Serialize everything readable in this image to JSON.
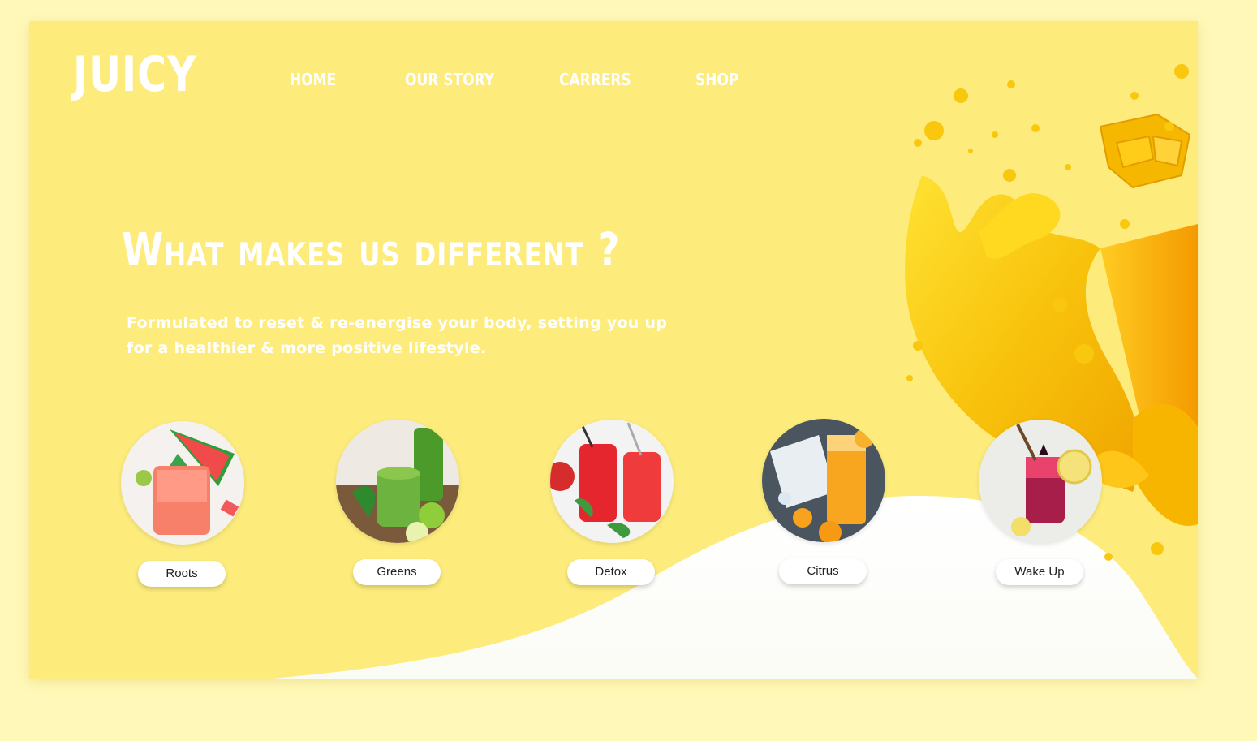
{
  "brand": {
    "logo": "JUICY"
  },
  "nav": [
    {
      "label": "HOME"
    },
    {
      "label": "OUR STORY"
    },
    {
      "label": "CARRERS"
    },
    {
      "label": "SHOP"
    }
  ],
  "hero": {
    "headline": "What makes us different ?",
    "subtitle": "Formulated to reset & re-energise your body, setting you up for a healthier & more positive lifestyle."
  },
  "products": [
    {
      "label": "Roots",
      "icon": "watermelon-smoothie-image"
    },
    {
      "label": "Greens",
      "icon": "green-smoothie-image"
    },
    {
      "label": "Detox",
      "icon": "red-juice-image"
    },
    {
      "label": "Citrus",
      "icon": "orange-juice-image"
    },
    {
      "label": "Wake Up",
      "icon": "berry-lemon-drink-image"
    }
  ],
  "colors": {
    "page_bg": "#fff8b8",
    "hero_bg": "#fdec7c",
    "juice": "#f5c20a",
    "white": "#ffffff"
  }
}
